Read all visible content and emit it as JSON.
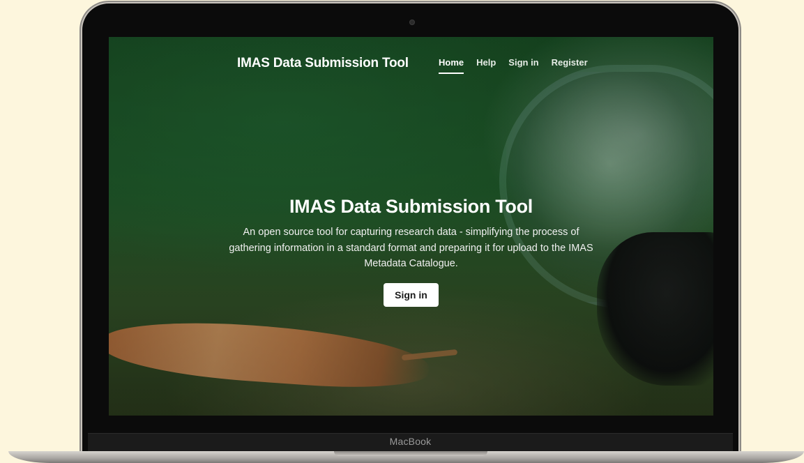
{
  "device": {
    "brand_label": "MacBook"
  },
  "navbar": {
    "brand": "IMAS Data Submission Tool",
    "links": [
      {
        "label": "Home",
        "active": true
      },
      {
        "label": "Help",
        "active": false
      },
      {
        "label": "Sign in",
        "active": false
      },
      {
        "label": "Register",
        "active": false
      }
    ]
  },
  "hero": {
    "title": "IMAS Data Submission Tool",
    "description": "An open source tool for capturing research data - simplifying the process of gathering information in a standard format and preparing it for upload to the IMAS Metadata Catalogue.",
    "button_label": "Sign in"
  },
  "colors": {
    "page_background": "#fdf6dd",
    "hero_green": "#1c4f24",
    "button_background": "#ffffff"
  }
}
